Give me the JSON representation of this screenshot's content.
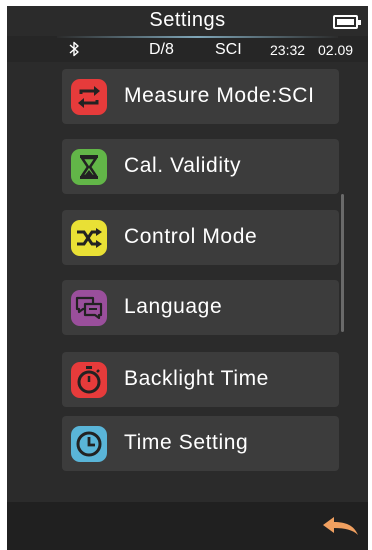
{
  "header": {
    "title": "Settings",
    "battery_icon": "battery-full-icon"
  },
  "status": {
    "bluetooth_icon": "bluetooth-icon",
    "geometry": "D/8",
    "mode": "SCI",
    "time": "23:32",
    "date": "02.09"
  },
  "menu": {
    "items": [
      {
        "label": "Measure Mode:SCI",
        "icon": "swap-arrows-icon",
        "color": "#e63b3b"
      },
      {
        "label": "Cal. Validity",
        "icon": "hourglass-icon",
        "color": "#62b648"
      },
      {
        "label": "Control Mode",
        "icon": "shuffle-icon",
        "color": "#e9e035"
      },
      {
        "label": "Language",
        "icon": "chat-bubbles-icon",
        "color": "#9a4f9c"
      },
      {
        "label": "Backlight Time",
        "icon": "stopwatch-icon",
        "color": "#e63b3b"
      },
      {
        "label": "Time Setting",
        "icon": "clock-icon",
        "color": "#5ab5d8"
      }
    ]
  },
  "footer": {
    "back_icon": "back-arrow-icon",
    "back_color": "#f0a060"
  }
}
